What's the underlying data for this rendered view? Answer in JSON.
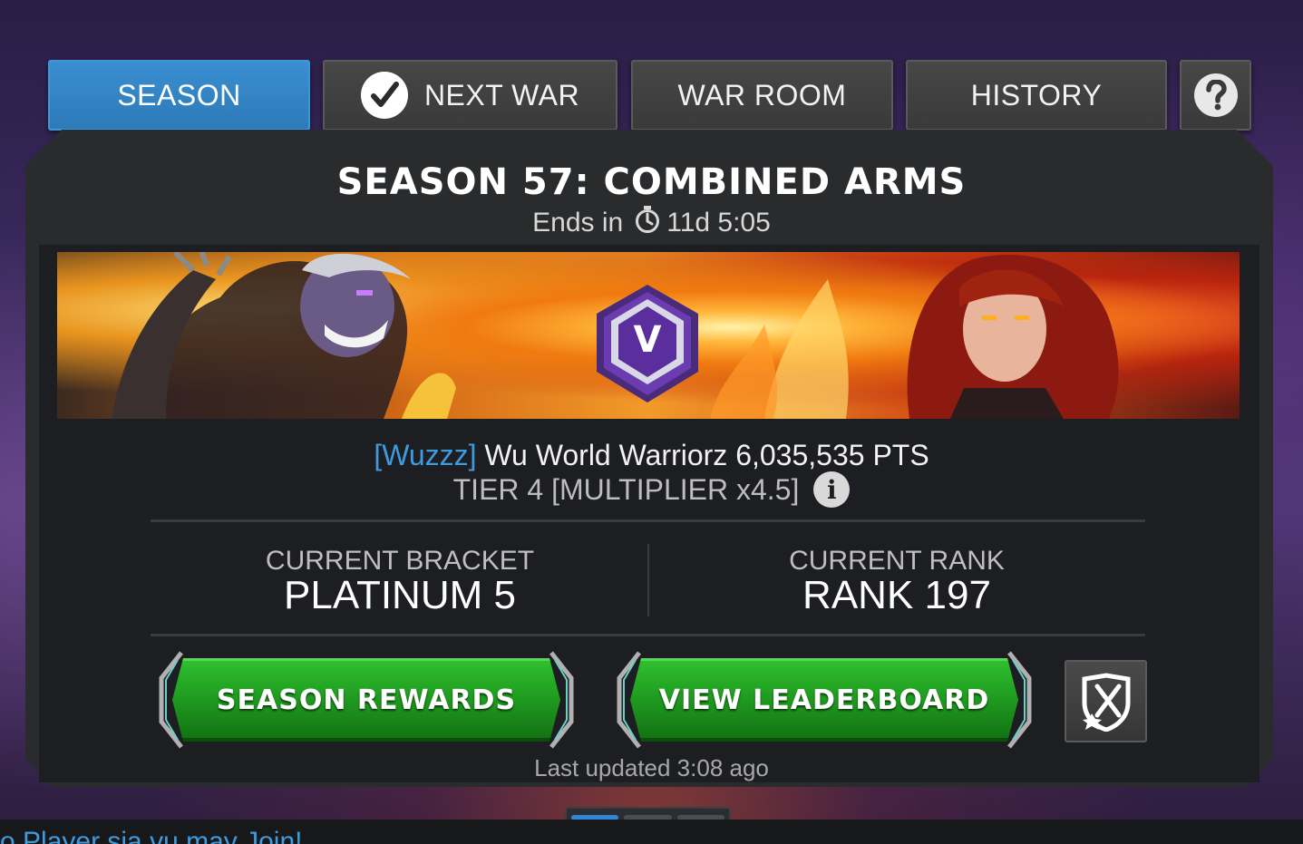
{
  "tabs": [
    {
      "label": "SEASON",
      "active": true
    },
    {
      "label": "NEXT WAR",
      "active": false,
      "icon": "check-icon"
    },
    {
      "label": "WAR ROOM",
      "active": false
    },
    {
      "label": "HISTORY",
      "active": false
    },
    {
      "label": "",
      "active": false,
      "icon": "help-icon"
    }
  ],
  "season": {
    "title": "SEASON 57: COMBINED ARMS",
    "ends_label": "Ends in",
    "ends_value": "11d 5:05",
    "badge_letter": "V"
  },
  "alliance": {
    "tag": "[Wuzzz]",
    "name": "Wu World Warriorz",
    "points": "6,035,535 PTS",
    "tier": "TIER 4 [MULTIPLIER x4.5]"
  },
  "stats": {
    "bracket_label": "CURRENT BRACKET",
    "bracket_value": "PLATINUM 5",
    "rank_label": "CURRENT RANK",
    "rank_value": "RANK 197"
  },
  "buttons": {
    "rewards": "SEASON REWARDS",
    "leaderboard": "VIEW LEADERBOARD",
    "war_icon": "war-shield-icon"
  },
  "last_updated": "Last updated 3:08 ago",
  "pager": {
    "pages": 3,
    "current": 1
  },
  "footer_text": "o Player sia vu may Join!",
  "colors": {
    "active_tab": "#2d7ab8",
    "alliance_tag": "#3f9be0",
    "button_green": "#1f9a1f"
  }
}
